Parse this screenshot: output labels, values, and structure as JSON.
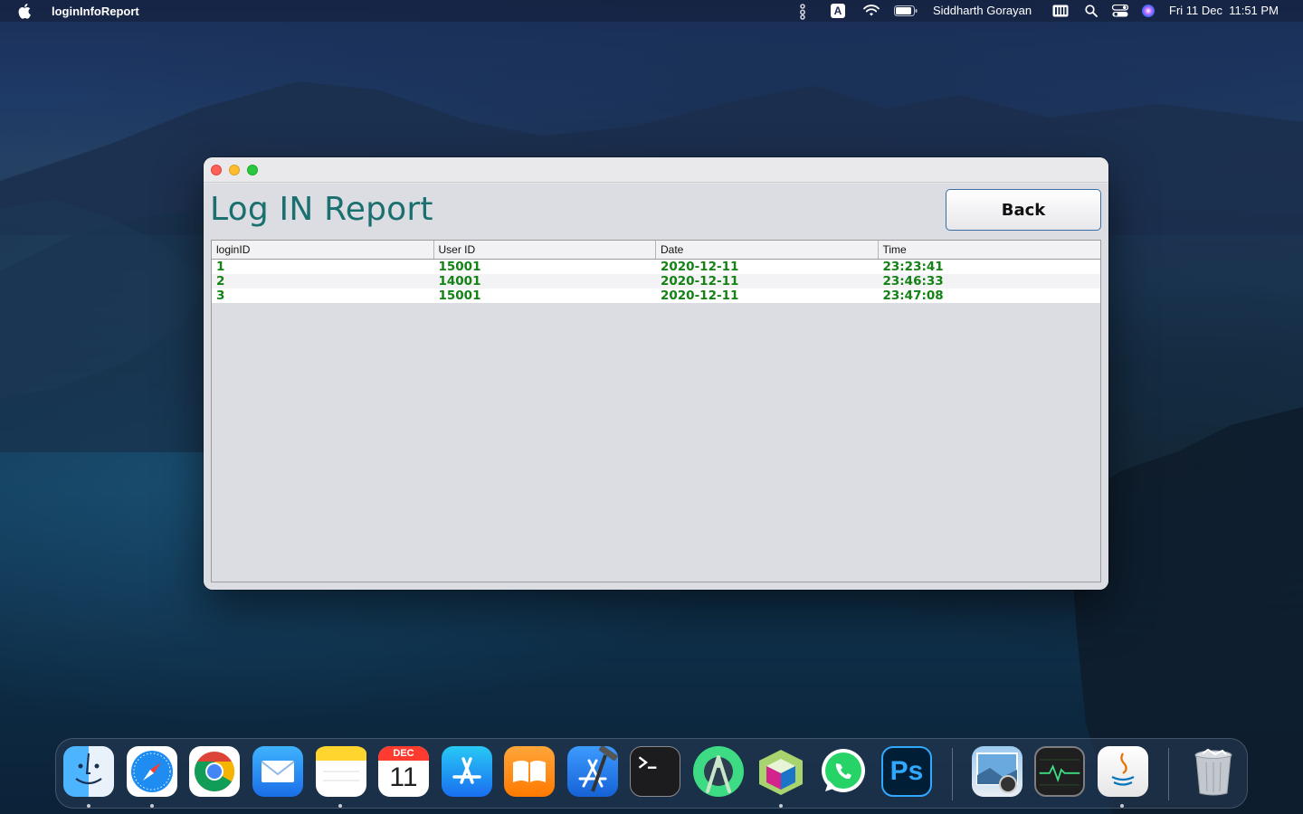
{
  "menubar": {
    "app_name": "loginInfoReport",
    "user": "Siddharth Gorayan",
    "datetime": "Fri 11 Dec  11:51 PM",
    "input_source": "A"
  },
  "window": {
    "title_heading": "Log IN Report",
    "back_button": "Back",
    "table": {
      "headers": [
        "loginID",
        "User ID",
        "Date",
        "Time"
      ],
      "rows": [
        [
          "1",
          "15001",
          "2020-12-11",
          "23:23:41"
        ],
        [
          "2",
          "14001",
          "2020-12-11",
          "23:46:33"
        ],
        [
          "3",
          "15001",
          "2020-12-11",
          "23:47:08"
        ]
      ]
    }
  },
  "dock": {
    "apps": [
      "finder-icon",
      "safari-icon",
      "chrome-icon",
      "mail-icon",
      "notes-icon",
      "calendar-icon",
      "app-store-icon",
      "books-icon",
      "xcode-icon",
      "terminal-icon",
      "android-studio-icon",
      "netbeans-icon",
      "whatsapp-icon",
      "photoshop-icon",
      "preview-icon",
      "activity-monitor-icon",
      "java-icon",
      "trash-icon"
    ],
    "calendar_month": "DEC",
    "calendar_day": "11",
    "photoshop_label": "Ps"
  },
  "colors": {
    "title": "#1a6f6f",
    "cell_text": "#148214",
    "button_border": "#3a6ea5"
  }
}
